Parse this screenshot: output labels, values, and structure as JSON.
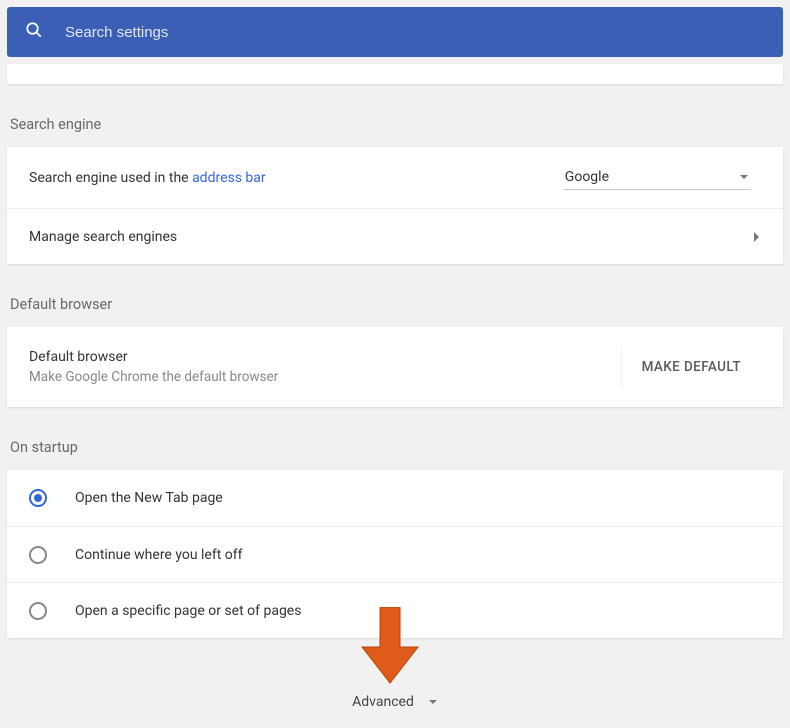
{
  "search": {
    "placeholder": "Search settings"
  },
  "sections": {
    "searchEngine": {
      "title": "Search engine",
      "usedInPrefix": "Search engine used in the ",
      "usedInLink": "address bar",
      "selected": "Google",
      "manage": "Manage search engines"
    },
    "defaultBrowser": {
      "title": "Default browser",
      "label": "Default browser",
      "sub": "Make Google Chrome the default browser",
      "button": "MAKE DEFAULT"
    },
    "startup": {
      "title": "On startup",
      "options": [
        "Open the New Tab page",
        "Continue where you left off",
        "Open a specific page or set of pages"
      ],
      "selectedIndex": 0
    }
  },
  "advanced": "Advanced"
}
